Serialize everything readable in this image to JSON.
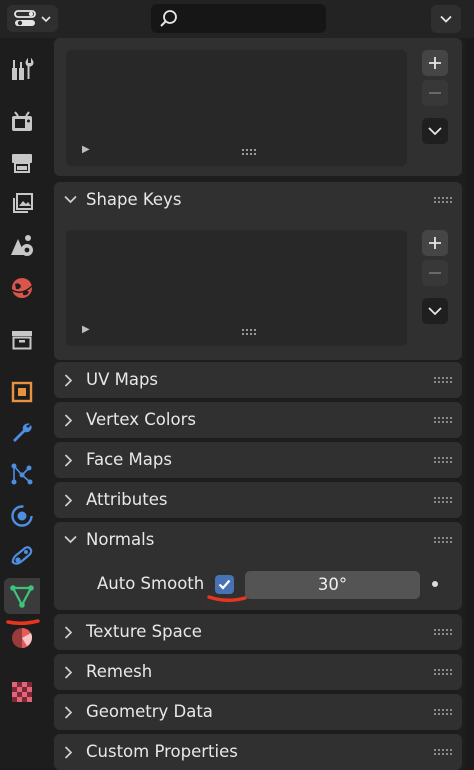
{
  "header": {
    "editor_type_icon": "properties-editor-icon",
    "search": {
      "value": "",
      "placeholder": "",
      "icon": "search-icon"
    }
  },
  "sidebar": {
    "tabs": [
      {
        "name": "tool-icon",
        "color": "#c7c7c7",
        "active": false
      },
      {
        "name": "render-icon",
        "color": "#c7c7c7",
        "active": false
      },
      {
        "name": "output-icon",
        "color": "#c7c7c7",
        "active": false
      },
      {
        "name": "view-layer-icon",
        "color": "#c7c7c7",
        "active": false
      },
      {
        "name": "scene-icon",
        "color": "#c7c7c7",
        "active": false
      },
      {
        "name": "world-icon",
        "color": "#d9564b",
        "active": false
      },
      {
        "name": "collection-icon",
        "color": "#c7c7c7",
        "active": false
      },
      {
        "name": "object-icon",
        "color": "#e8913f",
        "active": false
      },
      {
        "name": "modifier-icon",
        "color": "#4d8ee0",
        "active": false
      },
      {
        "name": "particles-icon",
        "color": "#4d8ee0",
        "active": false
      },
      {
        "name": "physics-icon",
        "color": "#4d8ee0",
        "active": false
      },
      {
        "name": "constraint-icon",
        "color": "#4d8ee0",
        "active": false
      },
      {
        "name": "object-data-icon",
        "color": "#3cc47c",
        "active": true
      },
      {
        "name": "material-icon",
        "color": "#e55a5a",
        "active": false
      },
      {
        "name": "texture-icon",
        "color": "#d94a5a",
        "active": false
      }
    ]
  },
  "panels": {
    "shape_keys": {
      "label": "Shape Keys",
      "expanded": true
    },
    "uv_maps": {
      "label": "UV Maps",
      "expanded": false
    },
    "vertex_colors": {
      "label": "Vertex Colors",
      "expanded": false
    },
    "face_maps": {
      "label": "Face Maps",
      "expanded": false
    },
    "attributes": {
      "label": "Attributes",
      "expanded": false
    },
    "normals": {
      "label": "Normals",
      "expanded": true,
      "auto_smooth_label": "Auto Smooth",
      "auto_smooth_checked": true,
      "angle": "30°"
    },
    "texture_space": {
      "label": "Texture Space",
      "expanded": false
    },
    "remesh": {
      "label": "Remesh",
      "expanded": false
    },
    "geometry_data": {
      "label": "Geometry Data",
      "expanded": false
    },
    "custom_properties": {
      "label": "Custom Properties",
      "expanded": false
    }
  },
  "colors": {
    "accent_checkbox": "#4772b3",
    "annotation_red": "#e8361e"
  }
}
